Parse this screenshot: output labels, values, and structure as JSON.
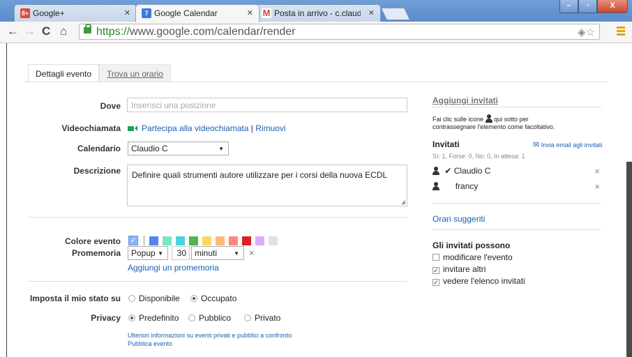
{
  "browser": {
    "tabs": [
      {
        "title": "Google+",
        "icon": "google-plus-icon",
        "color": "#dd4b39",
        "fav": "8+"
      },
      {
        "title": "Google Calendar",
        "icon": "calendar-icon",
        "color": "#3b7be0",
        "fav": "7"
      },
      {
        "title": "Posta in arrivo - c.claudio",
        "icon": "gmail-icon",
        "color": "#d14836",
        "fav": "M"
      }
    ],
    "url_scheme": "https://",
    "url_rest": "www.google.com/calendar/render"
  },
  "tabs": {
    "details": "Dettagli evento",
    "find_time": "Trova un orario"
  },
  "form": {
    "where_label": "Dove",
    "where_placeholder": "Inserisci una posizione",
    "video_label": "Videochiamata",
    "video_join": "Partecipa alla videochiamata",
    "video_sep": "|",
    "video_remove": "Rimuovi",
    "calendar_label": "Calendario",
    "calendar_value": "Claudio C",
    "description_label": "Descrizione",
    "description_value": "Definire quali strumenti autore utilizzare per i corsi della nuova ECDL",
    "color_label": "Colore evento",
    "colors": [
      "#a4bdfc",
      "#5484ed",
      "#7ae7bf",
      "#46d6db",
      "#51b749",
      "#fbd75b",
      "#ffb878",
      "#ff887c",
      "#dc2127",
      "#dbadff",
      "#e1e1e1"
    ],
    "reminder_label": "Promemoria",
    "reminder_type": "Popup",
    "reminder_amount": "30",
    "reminder_unit": "minuti",
    "reminder_remove": "×",
    "add_reminder": "Aggiungi un promemoria",
    "status_label": "Imposta il mio stato su",
    "status_available": "Disponibile",
    "status_busy": "Occupato",
    "privacy_label": "Privacy",
    "privacy_default": "Predefinito",
    "privacy_public": "Pubblico",
    "privacy_private": "Privato",
    "more_info": "Ulteriori informazioni su eventi privati e pubblici a confronto",
    "publish": "Pubblica evento"
  },
  "guests": {
    "add_title": "Aggiungi invitati",
    "hint_1": "Fai clic sulle icone",
    "hint_2": "qui sotto per",
    "hint_3": "contrassegnare l'elemento come facoltativo.",
    "invited_title": "Invitati",
    "email_link": "Invia email agli invitati",
    "summary": "Sì: 1, Forse: 0, No: 0, In attesa: 1",
    "list": [
      {
        "name": "Claudio C",
        "check": "✔"
      },
      {
        "name": "francy",
        "check": ""
      }
    ],
    "remove_symbol": "×",
    "suggested": "Orari suggeriti",
    "can_title": "Gli invitati possono",
    "perm_modify": "modificare l'evento",
    "perm_invite": "invitare altri",
    "perm_see": "vedere l'elenco invitati"
  }
}
